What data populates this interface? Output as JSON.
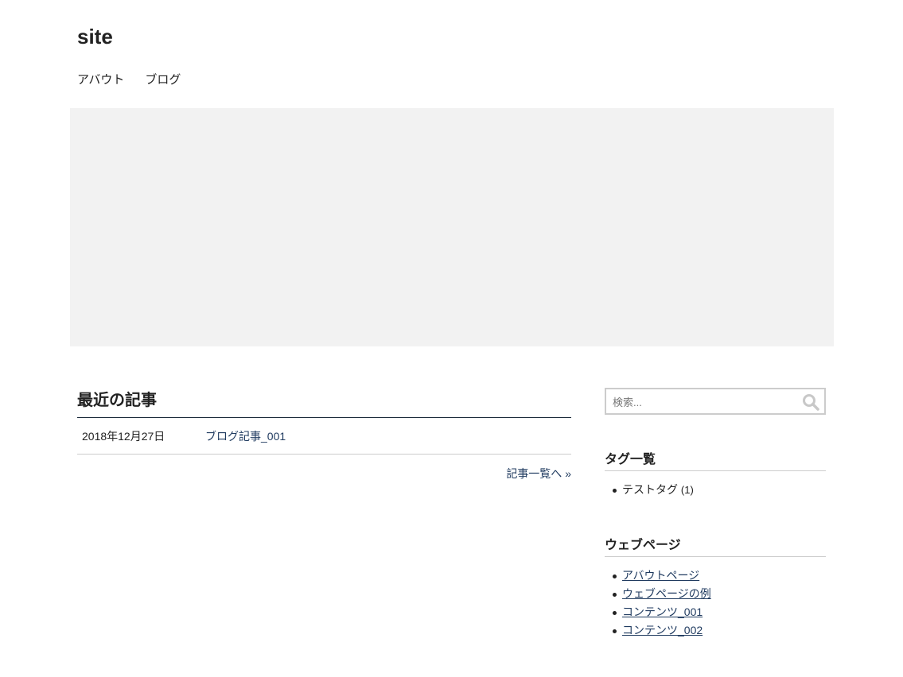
{
  "header": {
    "site_title": "site",
    "nav": [
      {
        "label": "アバウト"
      },
      {
        "label": "ブログ"
      }
    ]
  },
  "main": {
    "heading": "最近の記事",
    "posts": [
      {
        "date": "2018年12月27日",
        "title": "ブログ記事_001"
      }
    ],
    "more_link": "記事一覧へ »"
  },
  "sidebar": {
    "search": {
      "placeholder": "検索...",
      "value": "",
      "icon": "search-icon"
    },
    "tags": {
      "title": "タグ一覧",
      "items": [
        {
          "label": "テストタグ",
          "count": "(1)"
        }
      ]
    },
    "pages": {
      "title": "ウェブページ",
      "items": [
        {
          "label": "アバウトページ"
        },
        {
          "label": "ウェブページの例"
        },
        {
          "label": "コンテンツ_001"
        },
        {
          "label": "コンテンツ_002"
        }
      ]
    }
  },
  "colors": {
    "hero_background": "#f2f2f2",
    "link": "#1f3a5f",
    "heading_rule": "#1b2a3a"
  }
}
